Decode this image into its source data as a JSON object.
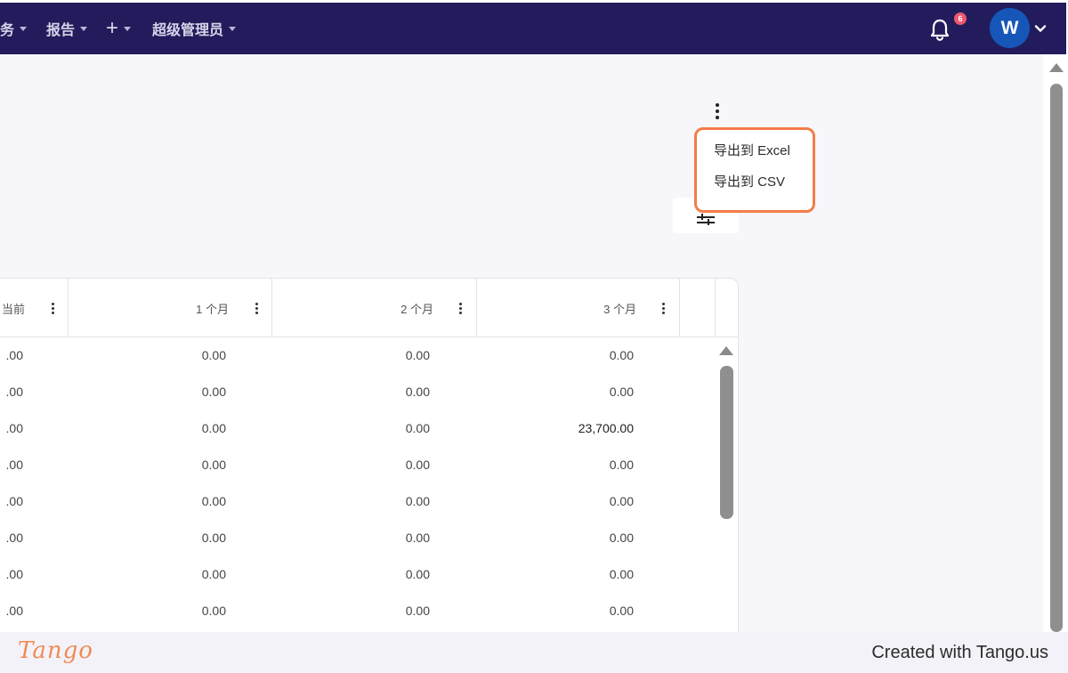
{
  "navbar": {
    "items": [
      {
        "label": "务"
      },
      {
        "label": "报告"
      },
      {
        "label": "+"
      },
      {
        "label": "超级管理员"
      }
    ],
    "notification_count": "6",
    "avatar_initial": "W"
  },
  "export_menu": {
    "items": [
      {
        "label": "导出到 Excel"
      },
      {
        "label": "导出到 CSV"
      }
    ]
  },
  "table": {
    "columns": [
      {
        "label": "当前"
      },
      {
        "label": "1 个月"
      },
      {
        "label": "2 个月"
      },
      {
        "label": "3 个月"
      }
    ],
    "rows": [
      [
        ".00",
        "0.00",
        "0.00",
        "0.00"
      ],
      [
        ".00",
        "0.00",
        "0.00",
        "0.00"
      ],
      [
        ".00",
        "0.00",
        "0.00",
        "23,700.00"
      ],
      [
        ".00",
        "0.00",
        "0.00",
        "0.00"
      ],
      [
        ".00",
        "0.00",
        "0.00",
        "0.00"
      ],
      [
        ".00",
        "0.00",
        "0.00",
        "0.00"
      ],
      [
        ".00",
        "0.00",
        "0.00",
        "0.00"
      ],
      [
        ".00",
        "0.00",
        "0.00",
        "0.00"
      ]
    ]
  },
  "footer": {
    "logo_text": "Tango",
    "created_text": "Created with Tango.us"
  },
  "colors": {
    "navbar_bg": "#221c5c",
    "highlight_border": "#f47c48",
    "badge": "#f0566e",
    "avatar": "#1656b8"
  }
}
